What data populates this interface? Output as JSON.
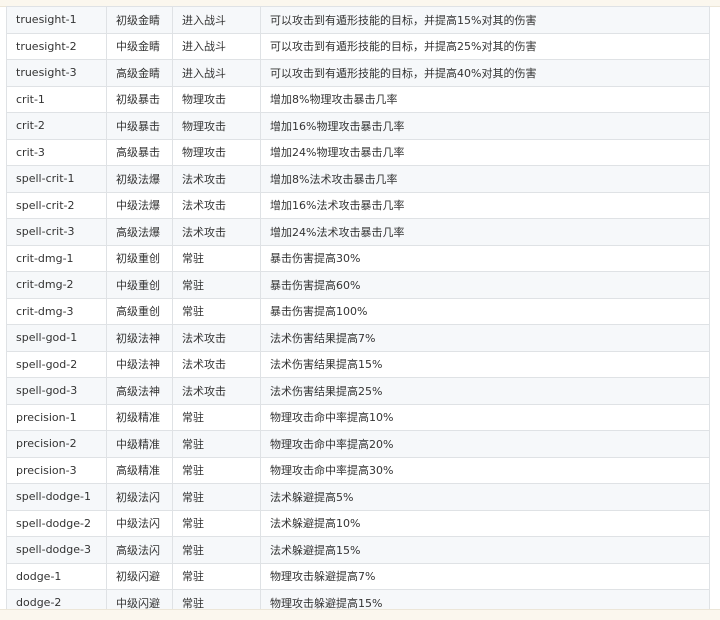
{
  "rows": [
    [
      "truesight-1",
      "初级金睛",
      "进入战斗",
      "可以攻击到有遁形技能的目标，并提高15%对其的伤害"
    ],
    [
      "truesight-2",
      "中级金睛",
      "进入战斗",
      "可以攻击到有遁形技能的目标，并提高25%对其的伤害"
    ],
    [
      "truesight-3",
      "高级金睛",
      "进入战斗",
      "可以攻击到有遁形技能的目标，并提高40%对其的伤害"
    ],
    [
      "crit-1",
      "初级暴击",
      "物理攻击",
      "增加8%物理攻击暴击几率"
    ],
    [
      "crit-2",
      "中级暴击",
      "物理攻击",
      "增加16%物理攻击暴击几率"
    ],
    [
      "crit-3",
      "高级暴击",
      "物理攻击",
      "增加24%物理攻击暴击几率"
    ],
    [
      "spell-crit-1",
      "初级法爆",
      "法术攻击",
      "增加8%法术攻击暴击几率"
    ],
    [
      "spell-crit-2",
      "中级法爆",
      "法术攻击",
      "增加16%法术攻击暴击几率"
    ],
    [
      "spell-crit-3",
      "高级法爆",
      "法术攻击",
      "增加24%法术攻击暴击几率"
    ],
    [
      "crit-dmg-1",
      "初级重创",
      "常驻",
      "暴击伤害提高30%"
    ],
    [
      "crit-dmg-2",
      "中级重创",
      "常驻",
      "暴击伤害提高60%"
    ],
    [
      "crit-dmg-3",
      "高级重创",
      "常驻",
      "暴击伤害提高100%"
    ],
    [
      "spell-god-1",
      "初级法神",
      "法术攻击",
      "法术伤害结果提高7%"
    ],
    [
      "spell-god-2",
      "中级法神",
      "法术攻击",
      "法术伤害结果提高15%"
    ],
    [
      "spell-god-3",
      "高级法神",
      "法术攻击",
      "法术伤害结果提高25%"
    ],
    [
      "precision-1",
      "初级精准",
      "常驻",
      "物理攻击命中率提高10%"
    ],
    [
      "precision-2",
      "中级精准",
      "常驻",
      "物理攻击命中率提高20%"
    ],
    [
      "precision-3",
      "高级精准",
      "常驻",
      "物理攻击命中率提高30%"
    ],
    [
      "spell-dodge-1",
      "初级法闪",
      "常驻",
      "法术躲避提高5%"
    ],
    [
      "spell-dodge-2",
      "中级法闪",
      "常驻",
      "法术躲避提高10%"
    ],
    [
      "spell-dodge-3",
      "高级法闪",
      "常驻",
      "法术躲避提高15%"
    ],
    [
      "dodge-1",
      "初级闪避",
      "常驻",
      "物理攻击躲避提高7%"
    ],
    [
      "dodge-2",
      "中级闪避",
      "常驻",
      "物理攻击躲避提高15%"
    ]
  ]
}
